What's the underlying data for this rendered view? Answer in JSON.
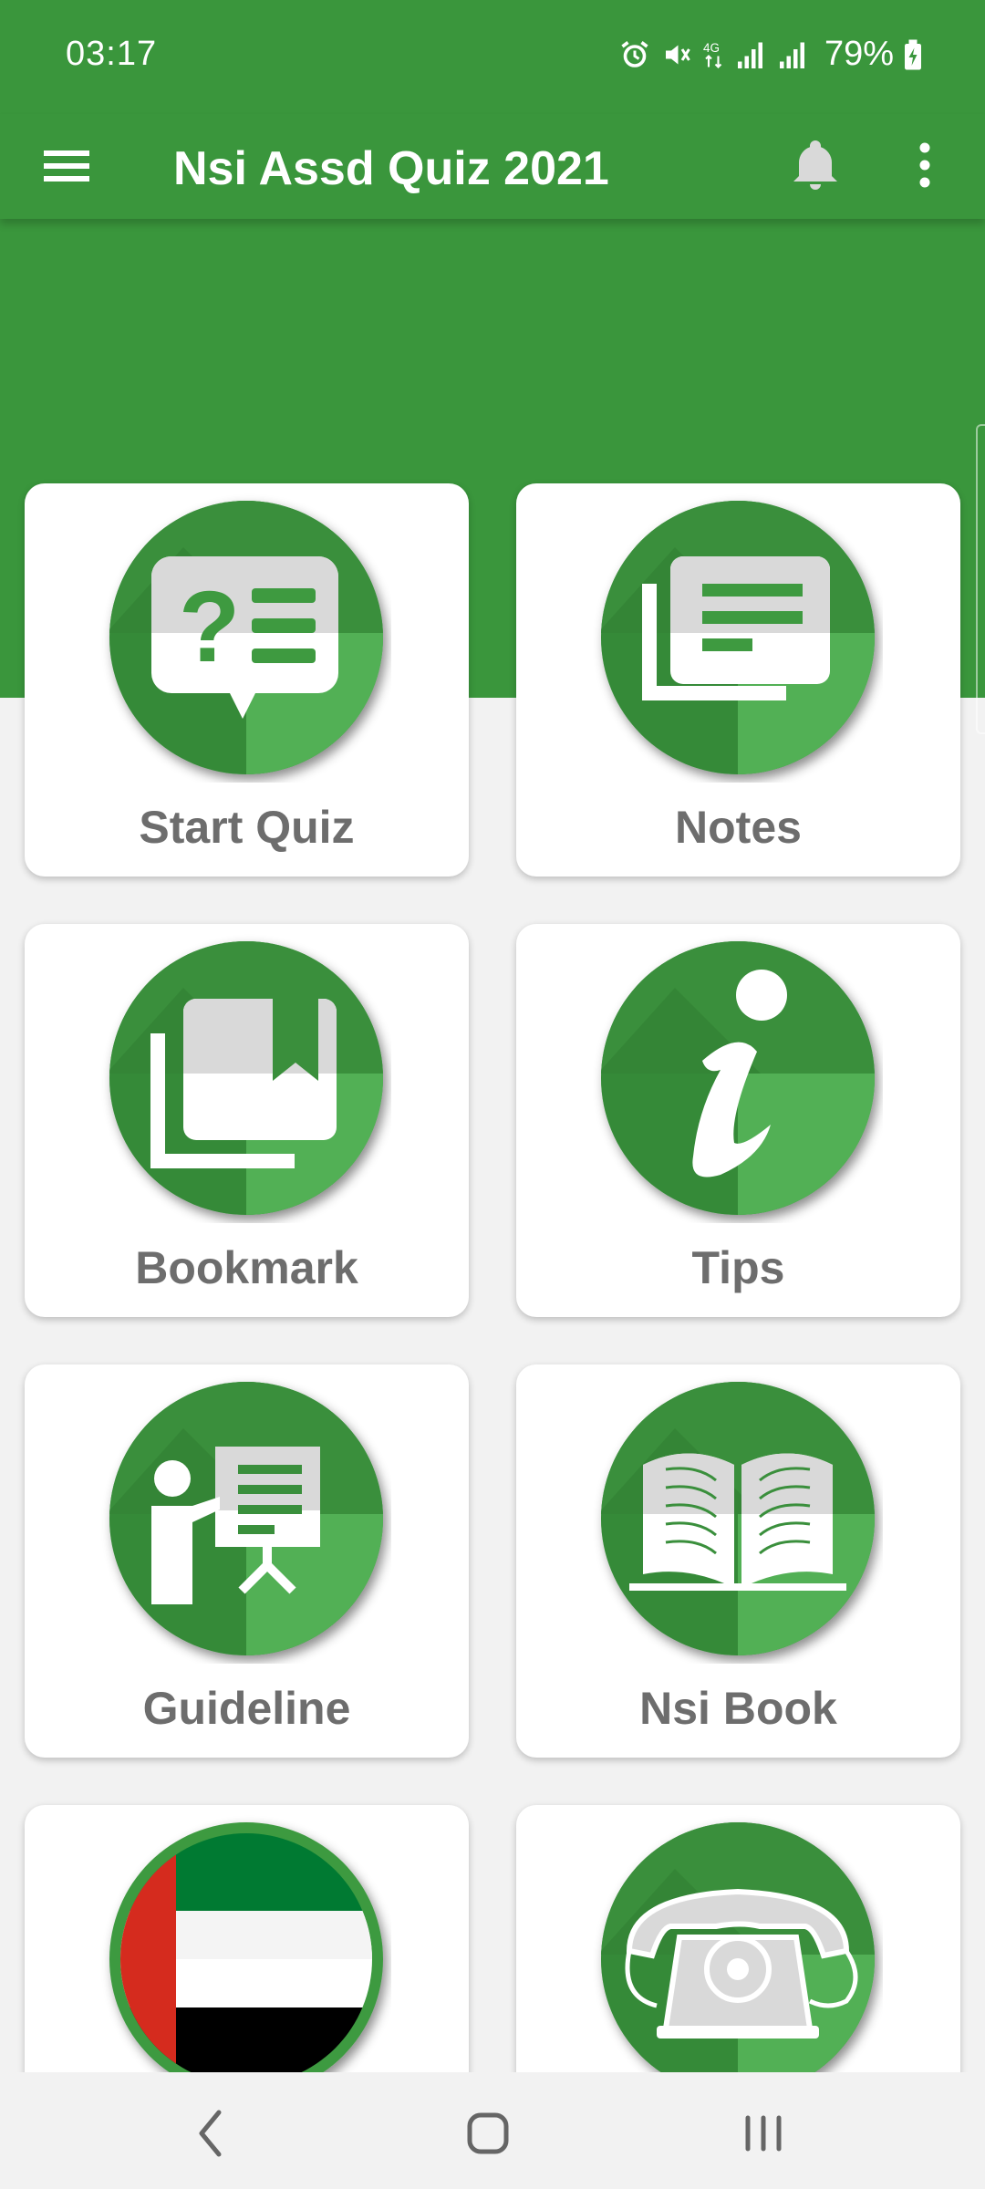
{
  "status_bar": {
    "time": "03:17",
    "battery": "79%",
    "icons": [
      "alarm-icon",
      "mute-icon",
      "4g-icon",
      "signal-icon",
      "signal-icon",
      "battery-charging-icon"
    ]
  },
  "app_bar": {
    "title": "Nsi Assd Quiz 2021",
    "icons": [
      "menu-icon",
      "bell-icon",
      "more-vert-icon"
    ]
  },
  "tiles": [
    {
      "label": "Start Quiz",
      "icon": "quiz-icon"
    },
    {
      "label": "Notes",
      "icon": "notes-icon"
    },
    {
      "label": "Bookmark",
      "icon": "bookmark-icon"
    },
    {
      "label": "Tips",
      "icon": "info-icon"
    },
    {
      "label": "Guideline",
      "icon": "presentation-icon"
    },
    {
      "label": "Nsi Book",
      "icon": "open-book-icon"
    },
    {
      "label": "",
      "icon": "uae-flag-icon"
    },
    {
      "label": "",
      "icon": "telephone-icon"
    }
  ],
  "nav_bar": {
    "icons": [
      "back-icon",
      "home-icon",
      "recents-icon"
    ]
  },
  "colors": {
    "primary": "#3a963c",
    "icon_circle": "#3e9a40",
    "tile_label": "#6d6d6d"
  }
}
